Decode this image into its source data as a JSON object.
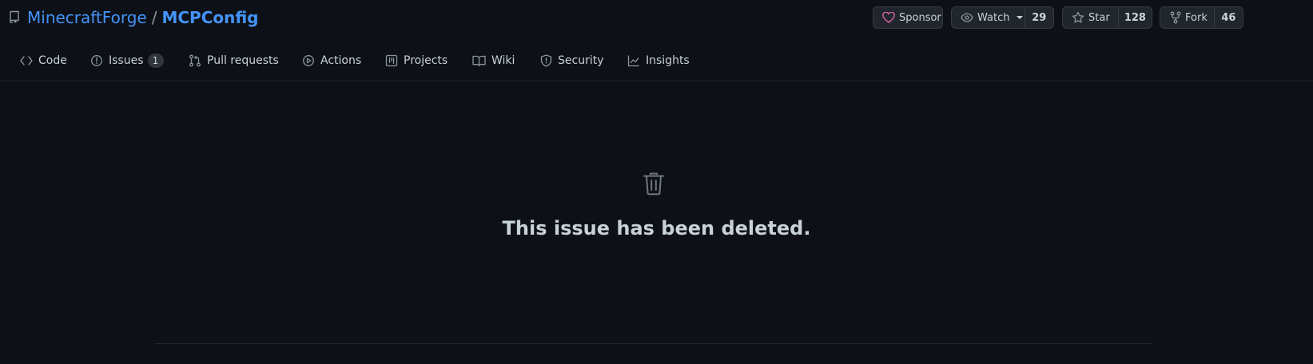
{
  "repo": {
    "owner": "MinecraftForge",
    "separator": "/",
    "name": "MCPConfig"
  },
  "actions": {
    "sponsor_label": "Sponsor",
    "watch_label": "Watch",
    "watch_count": "29",
    "star_label": "Star",
    "star_count": "128",
    "fork_label": "Fork",
    "fork_count": "46"
  },
  "tabs": [
    {
      "label": "Code",
      "icon": "code-icon"
    },
    {
      "label": "Issues",
      "icon": "issue-opened-icon",
      "counter": "1"
    },
    {
      "label": "Pull requests",
      "icon": "git-pull-request-icon"
    },
    {
      "label": "Actions",
      "icon": "play-icon"
    },
    {
      "label": "Projects",
      "icon": "table-icon"
    },
    {
      "label": "Wiki",
      "icon": "book-icon"
    },
    {
      "label": "Security",
      "icon": "shield-icon"
    },
    {
      "label": "Insights",
      "icon": "graph-icon"
    }
  ],
  "main": {
    "message": "This issue has been deleted.",
    "icon": "trash-icon"
  },
  "colors": {
    "background": "#0d1117",
    "link": "#4493f8",
    "sponsor_heart": "#db61a2",
    "muted": "#8d96a0"
  }
}
